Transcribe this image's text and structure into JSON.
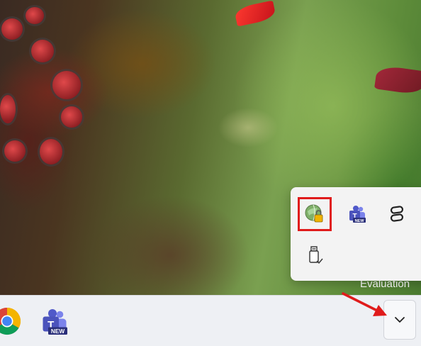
{
  "desktop": {
    "watermark_text": "Evaluation"
  },
  "tray_flyout": {
    "icons": [
      {
        "name": "vpn-lock-icon",
        "highlighted": true
      },
      {
        "name": "teams-new-icon",
        "badge": "NEW"
      },
      {
        "name": "link-icon"
      },
      {
        "name": "usb-icon"
      }
    ]
  },
  "taskbar": {
    "apps": [
      {
        "name": "chrome-icon"
      },
      {
        "name": "teams-icon",
        "badge": "NEW"
      }
    ],
    "show_hidden_icons": {
      "icon": "chevron-down-icon"
    }
  },
  "annotations": {
    "highlight_color": "#e01b1b",
    "arrow_color": "#e01b1b"
  }
}
